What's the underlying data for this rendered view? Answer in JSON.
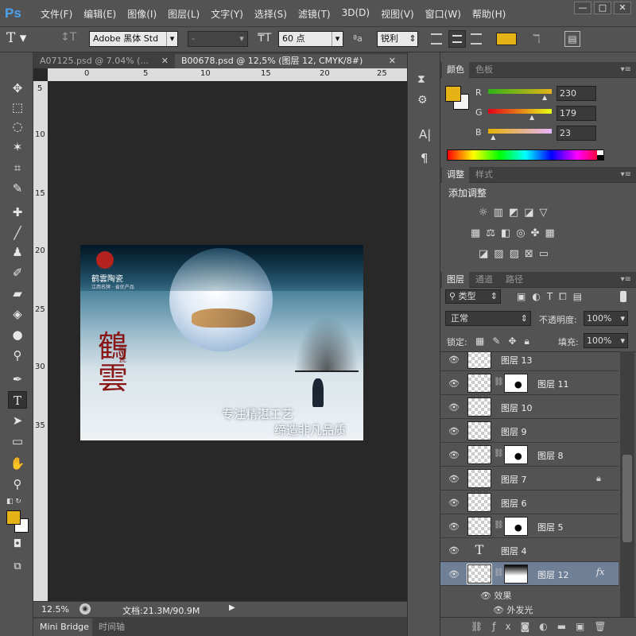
{
  "app": {
    "logo": "Ps"
  },
  "menu": [
    "文件(F)",
    "编辑(E)",
    "图像(I)",
    "图层(L)",
    "文字(Y)",
    "选择(S)",
    "滤镜(T)",
    "3D(D)",
    "视图(V)",
    "窗口(W)",
    "帮助(H)"
  ],
  "window_controls": [
    "—",
    "□",
    "✕"
  ],
  "options": {
    "font_family": "Adobe 黑体 Std",
    "font_style": "-",
    "font_size": "60 点",
    "aa_label": "ªa",
    "anti_alias": "锐利",
    "text_color": "#e6b317"
  },
  "tabs": [
    {
      "label": "A07125.psd @ 7.04% (...",
      "active": false
    },
    {
      "label": "B00678.psd @ 12,5% (图层 12, CMYK/8#)",
      "active": true
    }
  ],
  "ruler": {
    "h_ticks": [
      "0",
      "5",
      "10",
      "15",
      "20",
      "25"
    ],
    "v_ticks": [
      "5",
      "10",
      "15",
      "20",
      "25",
      "30",
      "35"
    ]
  },
  "artwork": {
    "brand": "鹤雲陶瓷",
    "brand_sub": "江西名牌 · 省优产品",
    "big_chars": "鶴雲",
    "small_chars": "陶瓷",
    "slogan1": "专注精湛工艺",
    "slogan2": "缔造非凡品质"
  },
  "status": {
    "zoom": "12.5%",
    "doc": "文档:21.3M/90.9M"
  },
  "bottom_tabs": [
    "Mini Bridge",
    "时间轴"
  ],
  "color_panel": {
    "tabs": [
      "颜色",
      "色板"
    ],
    "fg": "#e6b317",
    "r_label": "R",
    "g_label": "G",
    "b_label": "B",
    "r": "230",
    "g": "179",
    "b": "23",
    "r_frac": 0.9,
    "g_frac": 0.7,
    "b_frac": 0.09
  },
  "adjust_panel": {
    "tabs": [
      "调整",
      "样式"
    ],
    "title": "添加调整"
  },
  "layers_panel": {
    "tabs": [
      "图层",
      "通道",
      "路径"
    ],
    "filter": "类型",
    "blend": "正常",
    "opacity_label": "不透明度:",
    "opacity": "100%",
    "lock_label": "锁定:",
    "fill_label": "填充:",
    "fill": "100%",
    "layers": [
      {
        "name": "图层 13",
        "mask": false
      },
      {
        "name": "图层 11",
        "mask": true
      },
      {
        "name": "图层 10",
        "mask": false
      },
      {
        "name": "图层 9",
        "mask": false
      },
      {
        "name": "图层 8",
        "mask": true
      },
      {
        "name": "图层 7",
        "mask": false,
        "locked": true
      },
      {
        "name": "图层 6",
        "mask": false
      },
      {
        "name": "图层 5",
        "mask": true
      },
      {
        "name": "图层 4",
        "mask": false,
        "text": true
      },
      {
        "name": "图层 12",
        "mask": true,
        "selected": true,
        "fx": true
      }
    ],
    "effects_label": "效果",
    "effect_item": "外发光",
    "fx_label": "fx",
    "text_thumb": "T"
  }
}
